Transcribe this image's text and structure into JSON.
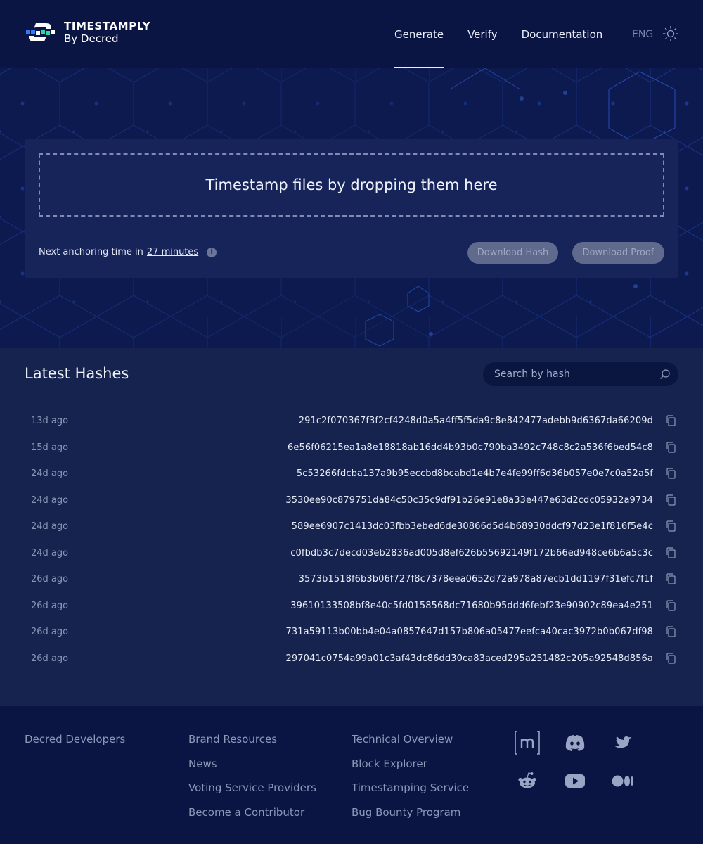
{
  "brand": {
    "title": "TIMESTAMPLY",
    "subtitle": "By Decred"
  },
  "nav": {
    "items": [
      {
        "label": "Generate",
        "active": true
      },
      {
        "label": "Verify",
        "active": false
      },
      {
        "label": "Documentation",
        "active": false
      }
    ],
    "language": "ENG",
    "theme_icon": "sun-icon"
  },
  "dropzone": {
    "label": "Timestamp files by dropping them here",
    "anchoring_prefix": "Next anchoring time in",
    "anchoring_value": "27 minutes",
    "info_icon": "info-icon",
    "download_hash_label": "Download Hash",
    "download_proof_label": "Download Proof"
  },
  "latest": {
    "title": "Latest Hashes",
    "search_placeholder": "Search by hash",
    "rows": [
      {
        "age": "13d ago",
        "hash": "291c2f070367f3f2cf4248d0a5a4ff5f5da9c8e842477adebb9d6367da66209d"
      },
      {
        "age": "15d ago",
        "hash": "6e56f06215ea1a8e18818ab16dd4b93b0c790ba3492c748c8c2a536f6bed54c8"
      },
      {
        "age": "24d ago",
        "hash": "5c53266fdcba137a9b95eccbd8bcabd1e4b7e4fe99ff6d36b057e0e7c0a52a5f"
      },
      {
        "age": "24d ago",
        "hash": "3530ee90c879751da84c50c35c9df91b26e91e8a33e447e63d2cdc05932a9734"
      },
      {
        "age": "24d ago",
        "hash": "589ee6907c1413dc03fbb3ebed6de30866d5d4b68930ddcf97d23e1f816f5e4c"
      },
      {
        "age": "24d ago",
        "hash": "c0fbdb3c7decd03eb2836ad005d8ef626b55692149f172b66ed948ce6b6a5c3c"
      },
      {
        "age": "26d ago",
        "hash": "3573b1518f6b3b06f727f8c7378eea0652d72a978a87ecb1dd1197f31efc7f1f"
      },
      {
        "age": "26d ago",
        "hash": "39610133508bf8e40c5fd0158568dc71680b95ddd6febf23e90902c89ea4e251"
      },
      {
        "age": "26d ago",
        "hash": "731a59113b00bb4e04a0857647d157b806a05477eefca40cac3972b0b067df98"
      },
      {
        "age": "26d ago",
        "hash": "297041c0754a99a01c3af43dc86dd30ca83aced295a251482c205a92548d856a"
      }
    ]
  },
  "footer": {
    "columns": [
      [
        "Decred Developers"
      ],
      [
        "Brand Resources",
        "News",
        "Voting Service Providers",
        "Become a Contributor"
      ],
      [
        "Technical Overview",
        "Block Explorer",
        "Timestamping Service",
        "Bug Bounty Program"
      ]
    ],
    "social": [
      "matrix-icon",
      "discord-icon",
      "twitter-icon",
      "reddit-icon",
      "youtube-icon",
      "medium-icon"
    ]
  },
  "colors": {
    "page_bg": "#0b1544",
    "hero_bg": "#0c1a4f",
    "card_bg": "#17245a",
    "list_bg": "#16234f",
    "button_bg": "#5f6a8c",
    "logo_blue": "#2f7bff",
    "logo_green": "#2ed6a1"
  }
}
